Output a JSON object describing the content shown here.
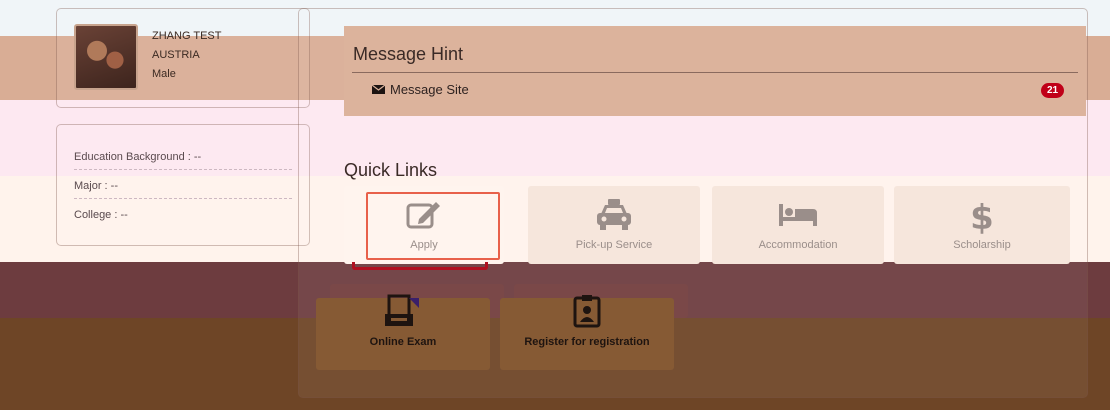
{
  "profile": {
    "name": "ZHANG TEST",
    "country": "AUSTRIA",
    "gender": "Male"
  },
  "info": {
    "education_background": "Education Background : --",
    "major": "Major : --",
    "college": "College : --"
  },
  "message_hint": {
    "title": "Message Hint",
    "link_label": "Message Site",
    "badge_count": "21",
    "icon": "envelope-icon"
  },
  "quick_links": {
    "title": "Quick Links",
    "items": [
      {
        "label": "Apply",
        "icon": "edit-icon"
      },
      {
        "label": "Pick-up Service",
        "icon": "taxi-icon"
      },
      {
        "label": "Accommodation",
        "icon": "bed-icon"
      },
      {
        "label": "Scholarship",
        "icon": "dollar-icon"
      },
      {
        "label": "Online Exam",
        "icon": "exam-icon"
      },
      {
        "label": "Register for registration",
        "icon": "register-icon"
      }
    ]
  },
  "colors": {
    "badge": "#c00018",
    "apply_focus": "#e8604a"
  }
}
